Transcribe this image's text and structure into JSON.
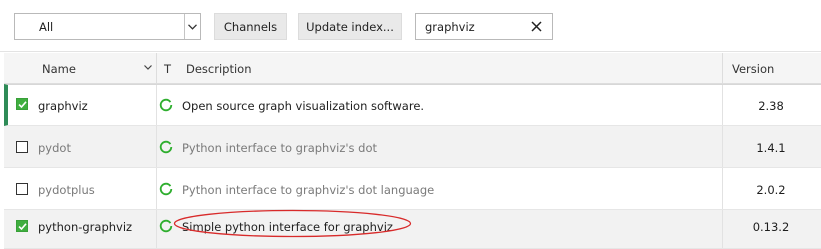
{
  "toolbar": {
    "filter_value": "All",
    "channels_label": "Channels",
    "update_label": "Update index...",
    "search_value": "graphviz"
  },
  "table": {
    "headers": {
      "name": "Name",
      "type": "T",
      "description": "Description",
      "version": "Version"
    },
    "rows": [
      {
        "name": "graphviz",
        "description": "Open source graph visualization software.",
        "version": "2.38",
        "installed": true
      },
      {
        "name": "pydot",
        "description": "Python interface to graphviz's dot",
        "version": "1.4.1",
        "installed": false
      },
      {
        "name": "pydotplus",
        "description": "Python interface to graphviz's dot language",
        "version": "2.0.2",
        "installed": false
      },
      {
        "name": "python-graphviz",
        "description": "Simple python interface for graphviz",
        "version": "0.13.2",
        "installed": true
      }
    ]
  },
  "colors": {
    "installed_green": "#3fae3f",
    "status_green": "#2eae2e",
    "highlight_red": "#d82a2a",
    "selected_bar": "#2e8b57"
  },
  "icons": [
    "chevron-down-icon",
    "close-icon",
    "checkbox-checked-icon",
    "checkbox-empty-icon",
    "status-ring-icon",
    "sort-chevron-icon"
  ]
}
